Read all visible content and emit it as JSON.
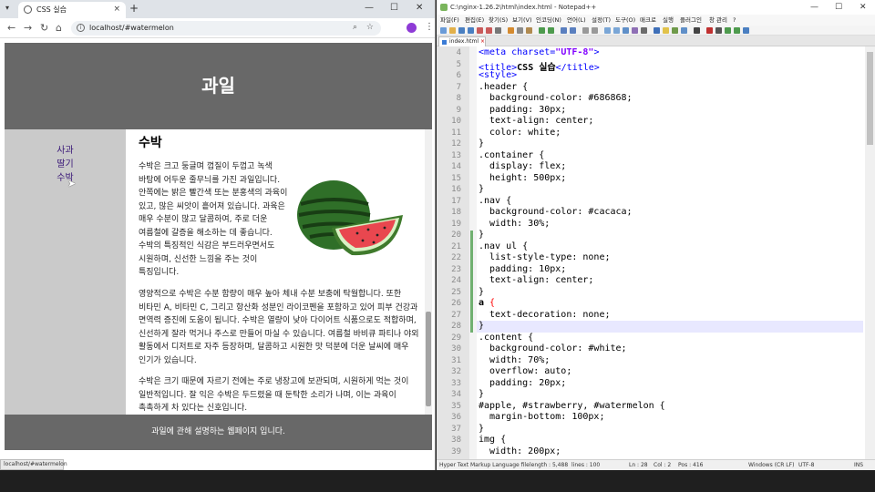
{
  "browser": {
    "tab_title": "CSS 실습",
    "tab_close": "×",
    "new_tab": "+",
    "win_min": "—",
    "win_max": "☐",
    "win_close": "✕",
    "url": "localhost/#watermelon",
    "status_url": "localhost/#watermelon"
  },
  "page": {
    "header": "과일",
    "nav_items": [
      "사과",
      "딸기",
      "수박"
    ],
    "content_title": "수박",
    "para1": "수박은 크고 둥글며 껍질이 두껍고 녹색 바탕에 어두운 줄무늬를 가진 과일입니다. 안쪽에는 밝은 빨간색 또는 분홍색의 과육이 있고, 많은 씨앗이 흩어져 있습니다. 과육은 매우 수분이 많고 달콤하여, 주로 더운 여름철에 갈증을 해소하는 데 좋습니다. 수박의 특징적인 식감은 부드러우면서도 시원하며, 신선한 느낌을 주는 것이 특징입니다.",
    "para2": "영양적으로 수박은 수분 함량이 매우 높아 체내 수분 보충에 탁월합니다. 또한 비타민 A, 비타민 C, 그리고 항산화 성분인 라이코펜을 포함하고 있어 피부 건강과 면역력 증진에 도움이 됩니다. 수박은 열량이 낮아 다이어트 식품으로도 적합하며, 신선하게 잘라 먹거나 주스로 만들어 마실 수 있습니다. 여름철 바비큐 파티나 야외 활동에서 디저트로 자주 등장하며, 달콤하고 시원한 맛 덕분에 더운 날씨에 매우 인기가 있습니다.",
    "para3": "수박은 크기 때문에 자르기 전에는 주로 냉장고에 보관되며, 시원하게 먹는 것이 일반적입니다. 잘 익은 수박은 두드렸을 때 둔탁한 소리가 나며, 이는 과육이 촉촉하게 차 있다는 신호입니다.",
    "footer": "과일에 관해 설명하는 웹페이지 입니다."
  },
  "npp": {
    "title": "C:\\nginx-1.26.2\\html\\index.html - Notepad++",
    "menu": [
      "파일(F)",
      "편집(E)",
      "찾기(S)",
      "보기(V)",
      "인코딩(N)",
      "언어(L)",
      "설정(T)",
      "도구(O)",
      "매크로",
      "실행",
      "플러그인",
      "창 관리",
      "?"
    ],
    "tab": "index.html",
    "line_numbers": [
      "4",
      "5",
      "6",
      "7",
      "8",
      "9",
      "10",
      "11",
      "12",
      "13",
      "14",
      "15",
      "16",
      "17",
      "18",
      "19",
      "20",
      "21",
      "22",
      "23",
      "24",
      "25",
      "26",
      "27",
      "28",
      "29",
      "30",
      "31",
      "32",
      "33",
      "34",
      "35",
      "36",
      "37",
      "38",
      "39"
    ],
    "code": {
      "l4a": "<meta charset=",
      "l4b": "\"UTF-8\"",
      "l4c": ">",
      "l5a": "<title>",
      "l5b": "CSS 실습",
      "l5c": "</title>",
      "l6": "<style>",
      "l7": ".header {",
      "l8": "  background-color: #686868;",
      "l9": "  padding: 30px;",
      "l10": "  text-align: center;",
      "l11": "  color: white;",
      "l12": "}",
      "l13": ".container {",
      "l14": "  display: flex;",
      "l15": "  height: 500px;",
      "l16": "}",
      "l17": ".nav {",
      "l18": "  background-color: #cacaca;",
      "l19": "  width: 30%;",
      "l20": "}",
      "l21": ".nav ul {",
      "l22": "  list-style-type: none;",
      "l23": "  padding: 10px;",
      "l24": "  text-align: center;",
      "l25": "}",
      "l26a": "a ",
      "l26b": "{",
      "l27": "  text-decoration: none;",
      "l28": "}",
      "l29": ".content {",
      "l30": "  background-color: #white;",
      "l31": "  width: 70%;",
      "l32": "  overflow: auto;",
      "l33": "  padding: 20px;",
      "l34": "}",
      "l35": "#apple, #strawberry, #watermelon {",
      "l36": "  margin-bottom: 100px;",
      "l37": "}",
      "l38": "img {",
      "l39": "  width: 200px;"
    },
    "status": {
      "lang": "Hyper Text Markup Language file",
      "length": "length : 5,488",
      "lines": "lines : 100",
      "ln": "Ln : 28",
      "col": "Col : 2",
      "pos": "Pos : 416",
      "eol": "Windows (CR LF)",
      "enc": "UTF-8",
      "mode": "INS"
    }
  },
  "colors": {
    "header_bg": "#686868",
    "nav_bg": "#cacaca",
    "link": "#3a1878"
  }
}
